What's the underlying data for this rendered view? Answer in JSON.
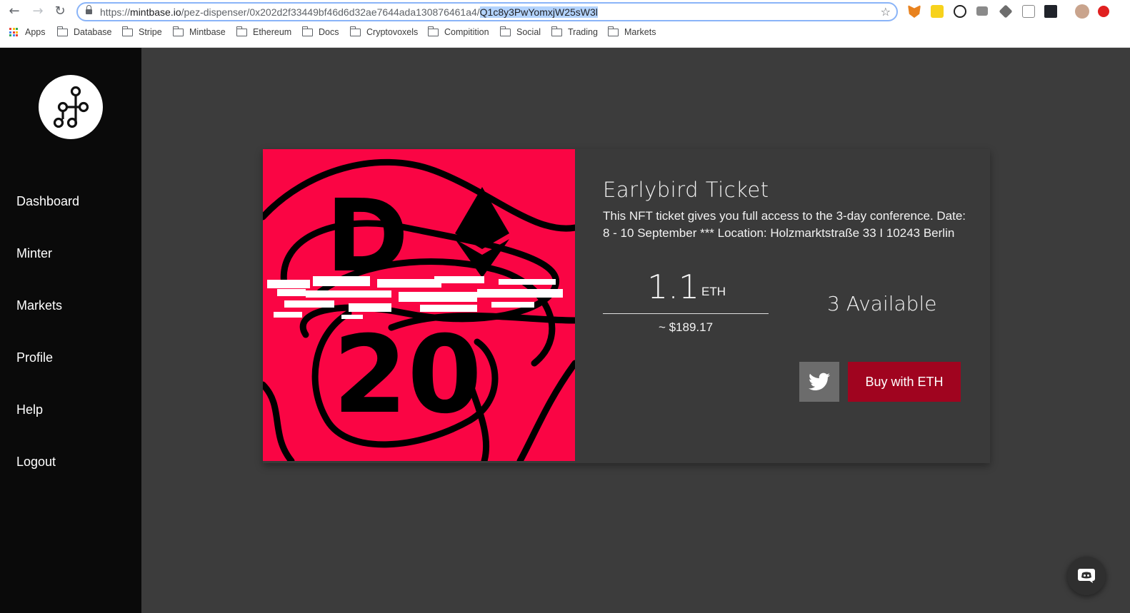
{
  "browser": {
    "url_prefix": "https://",
    "url_host": "mintbase.io",
    "url_path": "/pez-dispenser/0x202d2f33449bf46d6d32ae7644ada130876461a4/",
    "url_selected": "Q1c8y3PwYomxjW25sW3l",
    "bookmarks": [
      {
        "label": "Apps",
        "icon": "apps-grid-icon"
      },
      {
        "label": "Database",
        "icon": "folder-icon"
      },
      {
        "label": "Stripe",
        "icon": "folder-icon"
      },
      {
        "label": "Mintbase",
        "icon": "folder-icon"
      },
      {
        "label": "Ethereum",
        "icon": "folder-icon"
      },
      {
        "label": "Docs",
        "icon": "folder-icon"
      },
      {
        "label": "Cryptovoxels",
        "icon": "folder-icon"
      },
      {
        "label": "Compitition",
        "icon": "folder-icon"
      },
      {
        "label": "Social",
        "icon": "folder-icon"
      },
      {
        "label": "Trading",
        "icon": "folder-icon"
      },
      {
        "label": "Markets",
        "icon": "folder-icon"
      }
    ],
    "extensions": [
      "metamask-icon",
      "notes-icon",
      "panda-icon",
      "camera-icon",
      "cube-icon",
      "code-icon",
      "react-icon",
      "avatar-icon",
      "upload-icon"
    ]
  },
  "sidebar": {
    "items": [
      {
        "label": "Dashboard"
      },
      {
        "label": "Minter"
      },
      {
        "label": "Markets"
      },
      {
        "label": "Profile"
      },
      {
        "label": "Help"
      },
      {
        "label": "Logout"
      }
    ]
  },
  "product": {
    "title": "Earlybird Ticket",
    "description": "This NFT ticket gives you full access to the 3-day conference. Date: 8 - 10 September *** Location: Holzmarktstraße 33 I 10243 Berlin",
    "price": "1.1",
    "currency": "ETH",
    "price_usd": "~ $189.17",
    "available": "3 Available",
    "buy_label": "Buy with ETH",
    "art_text_top": "D",
    "art_text_bottom": "20",
    "colors": {
      "art_bg": "#fa0544",
      "buy_bg": "#a0041f"
    }
  }
}
